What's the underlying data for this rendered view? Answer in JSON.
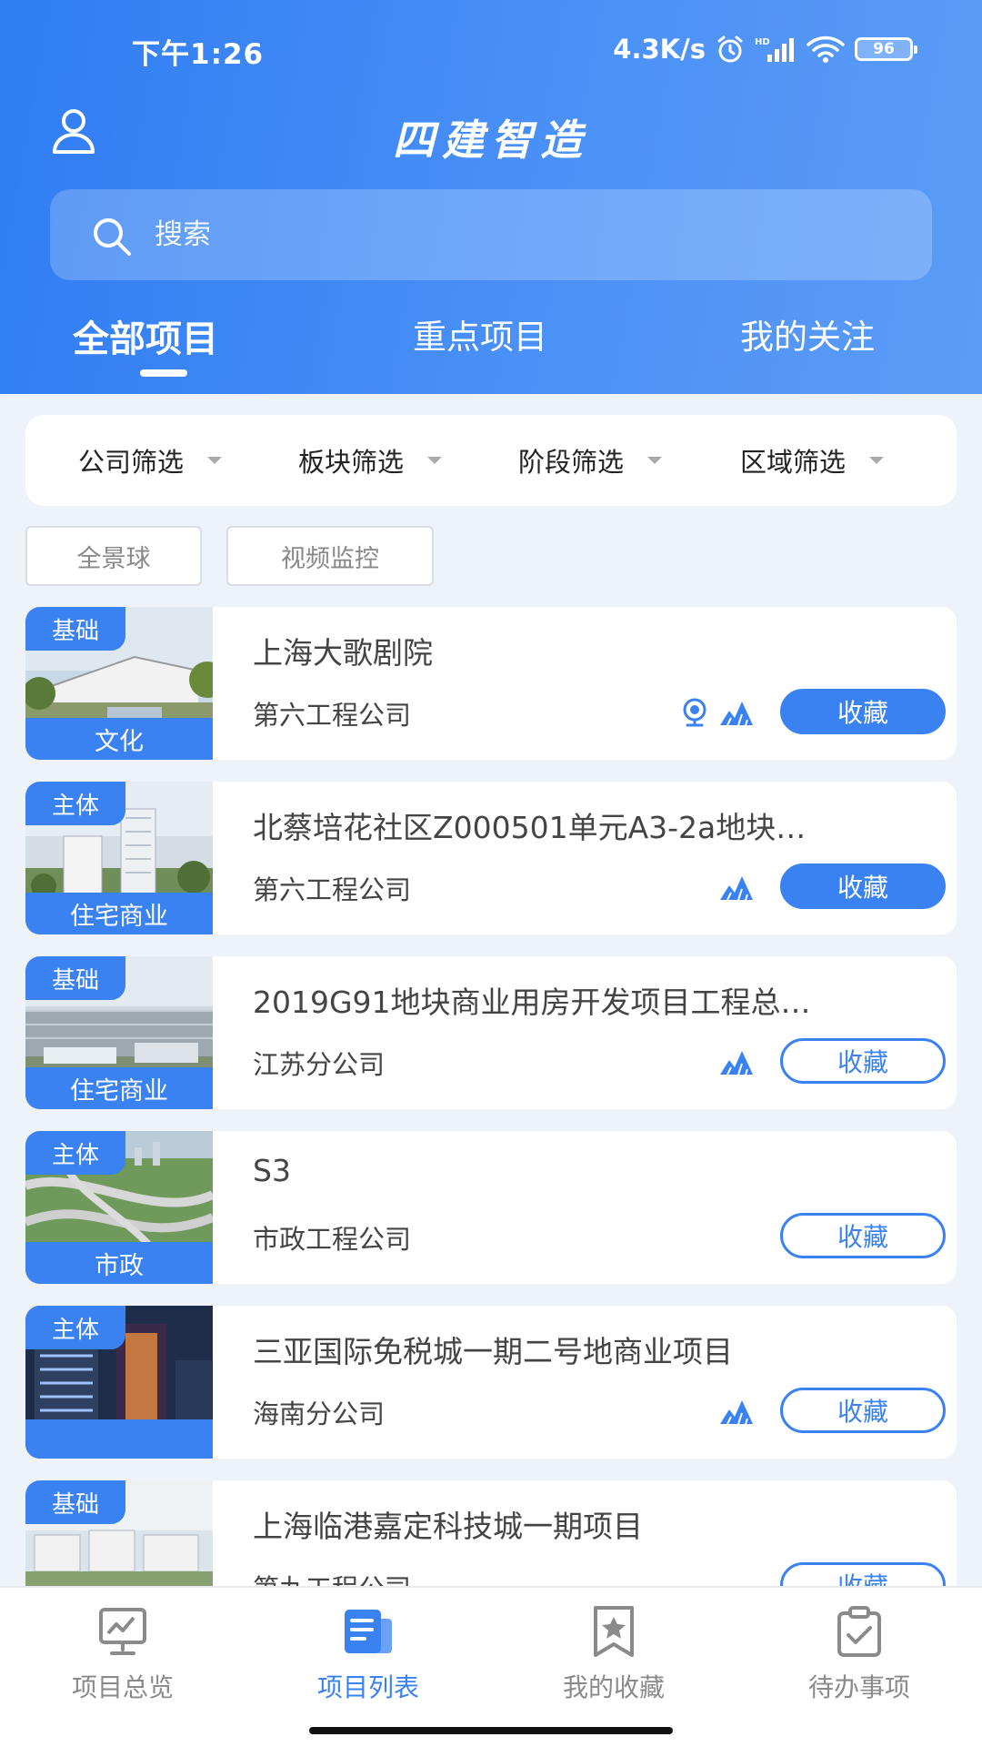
{
  "status": {
    "time": "下午1:26",
    "speed": "4.3K/s",
    "battery": "96"
  },
  "app": {
    "title": "四建智造"
  },
  "search": {
    "placeholder": "搜索"
  },
  "tabs": [
    {
      "label": "全部项目",
      "active": true
    },
    {
      "label": "重点项目",
      "active": false
    },
    {
      "label": "我的关注",
      "active": false
    }
  ],
  "filters": [
    {
      "label": "公司筛选"
    },
    {
      "label": "板块筛选"
    },
    {
      "label": "阶段筛选"
    },
    {
      "label": "区域筛选"
    }
  ],
  "chips": [
    {
      "label": "全景球"
    },
    {
      "label": "视频监控"
    }
  ],
  "projects": [
    {
      "tag": "基础",
      "category": "文化",
      "title": "上海大歌剧院",
      "company": "第六工程公司",
      "icons": [
        "camera-icon",
        "panorama-icon"
      ],
      "fav_label": "收藏",
      "fav_filled": true
    },
    {
      "tag": "主体",
      "category": "住宅商业",
      "title": "北蔡培花社区Z000501单元A3-2a地块…",
      "company": "第六工程公司",
      "icons": [
        "panorama-icon"
      ],
      "fav_label": "收藏",
      "fav_filled": true
    },
    {
      "tag": "基础",
      "category": "住宅商业",
      "title": "2019G91地块商业用房开发项目工程总…",
      "company": "江苏分公司",
      "icons": [
        "panorama-icon"
      ],
      "fav_label": "收藏",
      "fav_filled": false
    },
    {
      "tag": "主体",
      "category": "市政",
      "title": "S3",
      "company": "市政工程公司",
      "icons": [],
      "fav_label": "收藏",
      "fav_filled": false
    },
    {
      "tag": "主体",
      "category": "",
      "title": "三亚国际免税城一期二号地商业项目",
      "company": "海南分公司",
      "icons": [
        "panorama-icon"
      ],
      "fav_label": "收藏",
      "fav_filled": false
    },
    {
      "tag": "基础",
      "category": "",
      "title": "上海临港嘉定科技城一期项目",
      "company": "第九工程公司",
      "icons": [],
      "fav_label": "收藏",
      "fav_filled": false
    }
  ],
  "nav": [
    {
      "label": "项目总览",
      "active": false
    },
    {
      "label": "项目列表",
      "active": true
    },
    {
      "label": "我的收藏",
      "active": false
    },
    {
      "label": "待办事项",
      "active": false
    }
  ],
  "colors": {
    "accent": "#3a82f2",
    "header_start": "#2f7cf3",
    "header_end": "#5c9cf7"
  }
}
